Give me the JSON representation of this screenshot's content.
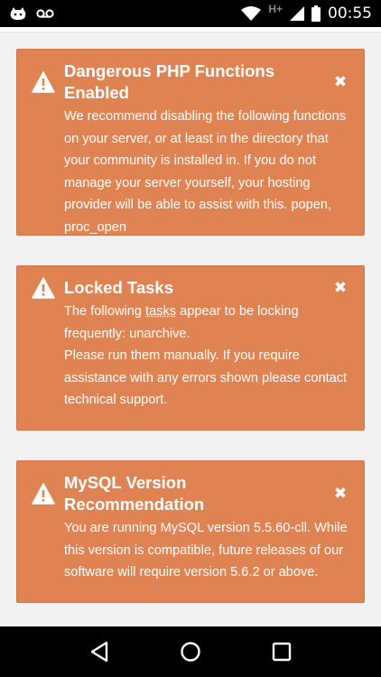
{
  "status_bar": {
    "network_label": "H+",
    "time": "00:55",
    "icons": [
      "cat-notification-icon",
      "voicemail-icon",
      "wifi-icon",
      "signal-icon",
      "battery-icon"
    ]
  },
  "alerts": [
    {
      "title": "Dangerous PHP Functions Enabled",
      "body": "We recommend disabling the following functions on your server, or at least in the directory that your community is installed in. If you do not manage your server yourself, your hosting provider will be able to assist with this. popen, proc_open",
      "close_glyph": "✖"
    },
    {
      "title": "Locked Tasks",
      "body_pre": "The following ",
      "body_link": "tasks",
      "body_post": " appear to be locking frequently: unarchive.",
      "body_line2": "Please run them manually. If you require assistance with any errors shown please contact technical support.",
      "close_glyph": "✖"
    },
    {
      "title": "MySQL Version Recommendation",
      "body": "You are running MySQL version 5.5.60-cll. While this version is compatible, future releases of our software will require version 5.6.2 or above.",
      "close_glyph": "✖"
    }
  ],
  "colors": {
    "alert_bg": "#e08353",
    "alert_border": "#cf7447",
    "page_bg": "#f2f2f2"
  },
  "nav_bar": {
    "buttons": [
      "back-icon",
      "home-icon",
      "recents-icon"
    ]
  }
}
